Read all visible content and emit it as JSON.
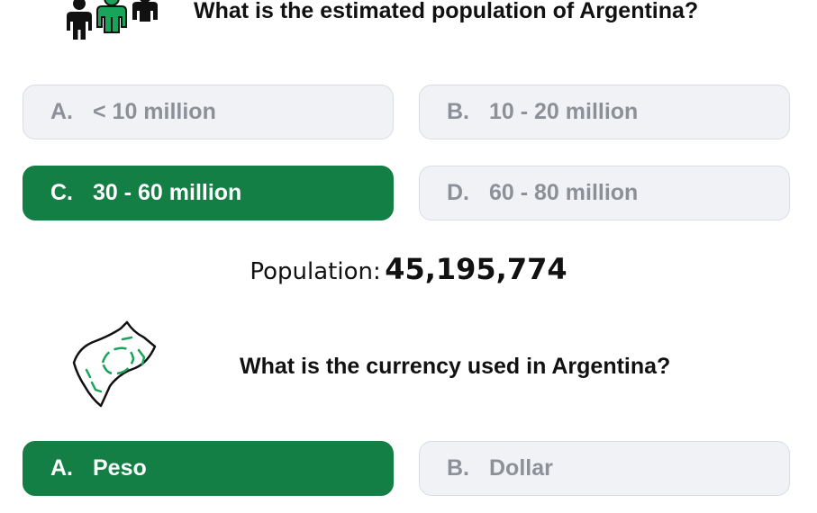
{
  "icons": {
    "people": "people-icon",
    "money": "money-bill-icon",
    "people_colors": [
      "#111111",
      "#1aa35a",
      "#111111"
    ],
    "money_accent": "#1aa35a"
  },
  "colors": {
    "correct_bg": "#147f45",
    "option_bg": "#f0f2f5",
    "option_text": "#8d9197"
  },
  "question1": {
    "text": "What is the estimated population of Argentina?",
    "options": [
      {
        "letter": "A.",
        "label": "< 10 million",
        "state": "neutral"
      },
      {
        "letter": "B.",
        "label": "10 - 20 million",
        "state": "neutral"
      },
      {
        "letter": "C.",
        "label": "30 - 60 million",
        "state": "correct"
      },
      {
        "letter": "D.",
        "label": "60 - 80 million",
        "state": "neutral"
      }
    ],
    "fact_label": "Population:",
    "fact_value": "45,195,774"
  },
  "question2": {
    "text": "What is the currency used in Argentina?",
    "options": [
      {
        "letter": "A.",
        "label": "Peso",
        "state": "correct"
      },
      {
        "letter": "B.",
        "label": "Dollar",
        "state": "neutral"
      }
    ]
  }
}
